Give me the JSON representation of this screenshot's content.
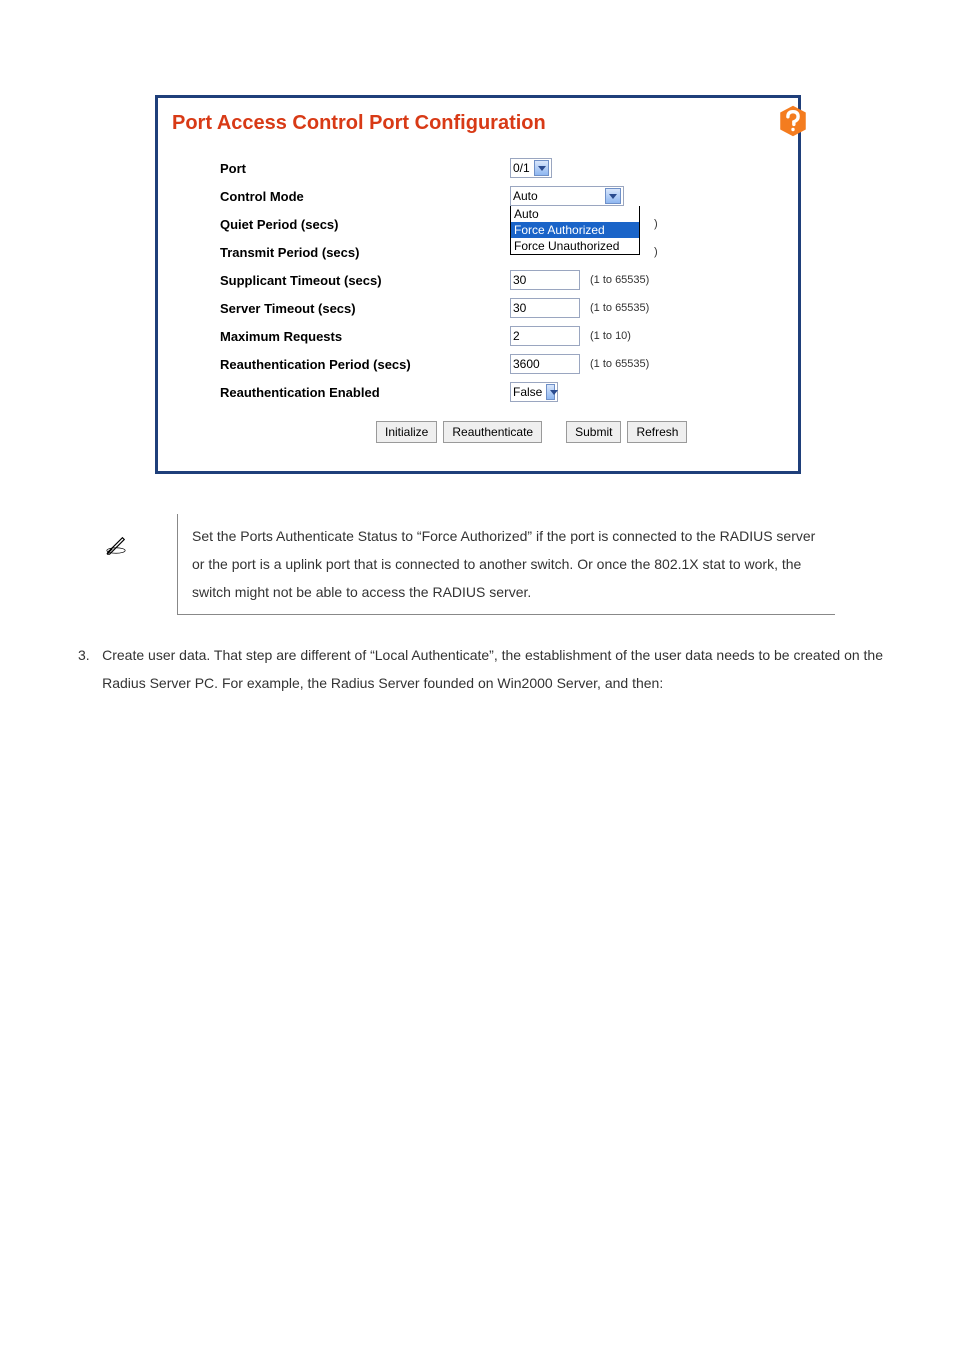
{
  "panel": {
    "title": "Port Access Control Port Configuration",
    "port_label": "Port",
    "port_value": "0/1",
    "control_mode_label": "Control Mode",
    "control_mode_value": "Auto",
    "control_mode_options": {
      "auto": "Auto",
      "force_auth": "Force Authorized",
      "force_unauth": "Force Unauthorized"
    },
    "quiet_label": "Quiet Period (secs)",
    "quiet_hint_tail": ")",
    "transmit_label": "Transmit Period (secs)",
    "transmit_hint_tail": ")",
    "supplicant_label": "Supplicant Timeout (secs)",
    "supplicant_value": "30",
    "supplicant_hint": "(1 to 65535)",
    "server_label": "Server Timeout (secs)",
    "server_value": "30",
    "server_hint": "(1 to 65535)",
    "maxreq_label": "Maximum Requests",
    "maxreq_value": "2",
    "maxreq_hint": "(1 to 10)",
    "reauthp_label": "Reauthentication Period (secs)",
    "reauthp_value": "3600",
    "reauthp_hint": "(1 to 65535)",
    "reauthen_label": "Reauthentication Enabled",
    "reauthen_value": "False",
    "buttons": {
      "initialize": "Initialize",
      "reauthenticate": "Reauthenticate",
      "submit": "Submit",
      "refresh": "Refresh"
    }
  },
  "note": {
    "text": "Set the Ports Authenticate Status to “Force Authorized” if the port is connected to the RADIUS server or the port is a uplink port that is connected to another switch. Or once the 802.1X stat to work, the switch might not be able to access the RADIUS server."
  },
  "body": {
    "num": "3.",
    "text": "Create user data. That step are different of “Local Authenticate”, the establishment of the user data needs to be created on the Radius Server PC. For example, the Radius Server founded on Win2000 Server, and then:"
  }
}
